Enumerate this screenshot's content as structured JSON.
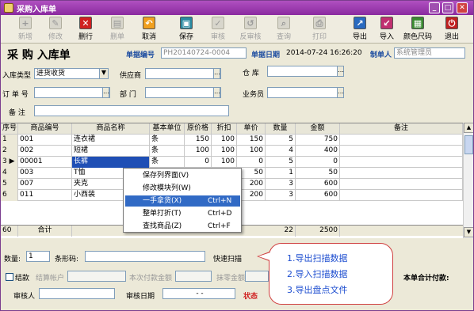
{
  "window": {
    "title": "采购入库单"
  },
  "toolbar": {
    "items": [
      {
        "label": "新增",
        "icon": "plus-icon",
        "enabled": false
      },
      {
        "label": "修改",
        "icon": "edit-icon",
        "enabled": false
      },
      {
        "label": "删行",
        "icon": "delete-row-icon",
        "enabled": true,
        "color": "#d02020"
      },
      {
        "label": "删单",
        "icon": "delete-doc-icon",
        "enabled": false
      },
      {
        "label": "取消",
        "icon": "cancel-icon",
        "enabled": true,
        "color": "#f0a020"
      },
      {
        "label": "保存",
        "icon": "save-icon",
        "enabled": true,
        "color": "#2a8aa0"
      },
      {
        "label": "审核",
        "icon": "approve-icon",
        "enabled": false
      },
      {
        "label": "反审核",
        "icon": "unapprove-icon",
        "enabled": false
      },
      {
        "label": "查询",
        "icon": "search-icon",
        "enabled": false
      },
      {
        "label": "打印",
        "icon": "print-icon",
        "enabled": false
      },
      {
        "label": "导出",
        "icon": "export-icon",
        "enabled": true,
        "color": "#2a6ac0"
      },
      {
        "label": "导入",
        "icon": "import-icon",
        "enabled": true,
        "color": "#c03070"
      },
      {
        "label": "颜色尺码",
        "icon": "grid-icon",
        "enabled": true,
        "color": "#3a8a30"
      },
      {
        "label": "退出",
        "icon": "exit-icon",
        "enabled": true,
        "color": "#c02020"
      }
    ]
  },
  "header": {
    "heading": "采 购 入库单",
    "doc_no_label": "单据编号",
    "doc_no_value": "PH20140724-0004",
    "doc_date_label": "单据日期",
    "doc_date_value": "2014-07-24 16:26:20",
    "maker_label": "制单人",
    "maker_value": "系统管理员",
    "type_label": "入库类型",
    "type_value": "进货收货",
    "supplier_label": "供应商",
    "warehouse_label": "仓    库",
    "order_label": "订 单 号",
    "dept_label": "部    门",
    "clerk_label": "业务员",
    "remark_label": "备    注"
  },
  "grid": {
    "columns": [
      "序号",
      "商品编号",
      "商品名称",
      "基本单位",
      "原价格",
      "折扣",
      "单价",
      "数量",
      "金额",
      "备注"
    ],
    "rows": [
      {
        "idx": "1",
        "code": "001",
        "name": "连衣裙",
        "unit": "条",
        "orig": "150",
        "disc": "100",
        "price": "150",
        "qty": "5",
        "amount": "750",
        "note": ""
      },
      {
        "idx": "2",
        "code": "002",
        "name": "短裙",
        "unit": "条",
        "orig": "100",
        "disc": "100",
        "price": "100",
        "qty": "4",
        "amount": "400",
        "note": ""
      },
      {
        "idx": "3",
        "code": "00001",
        "name": "长裤",
        "unit": "条",
        "orig": "0",
        "disc": "100",
        "price": "0",
        "qty": "5",
        "amount": "0",
        "note": ""
      },
      {
        "idx": "4",
        "code": "003",
        "name": "T恤",
        "unit": "",
        "orig": "",
        "disc": "",
        "price": "50",
        "qty": "1",
        "amount": "50",
        "note": ""
      },
      {
        "idx": "5",
        "code": "007",
        "name": "夹克",
        "unit": "",
        "orig": "",
        "disc": "",
        "price": "200",
        "qty": "3",
        "amount": "600",
        "note": ""
      },
      {
        "idx": "6",
        "code": "011",
        "name": "小西装",
        "unit": "",
        "orig": "",
        "disc": "",
        "price": "200",
        "qty": "3",
        "amount": "600",
        "note": ""
      }
    ],
    "totals": {
      "idx": "60",
      "label": "合计",
      "qty": "22",
      "amount": "2500"
    }
  },
  "context_menu": {
    "items": [
      {
        "label": "保存列界面(V)",
        "shortcut": ""
      },
      {
        "label": "修改模块列(W)",
        "shortcut": ""
      },
      {
        "label": "一手拿货(X)",
        "shortcut": "Ctrl+N"
      },
      {
        "label": "整单打折(T)",
        "shortcut": "Ctrl+D"
      },
      {
        "label": "查找商品(Z)",
        "shortcut": "Ctrl+F"
      }
    ]
  },
  "bottom": {
    "qty_label": "数量:",
    "qty_value": "1",
    "barcode_label": "条形码:",
    "quick_scan_label": "快速扫描",
    "settle_label": "结款",
    "account_label": "结算帐户",
    "paid_label": "本次付款金额",
    "discount_label": "抹零金额",
    "total_label": "本单合计付款:",
    "auditor_label": "审核人",
    "audit_date_label": "审核日期",
    "audit_date_value": "-  -",
    "status_label": "状态"
  },
  "callout": {
    "lines": [
      "1.导出扫描数据",
      "2.导入扫描数据",
      "3.导出盘点文件"
    ]
  }
}
